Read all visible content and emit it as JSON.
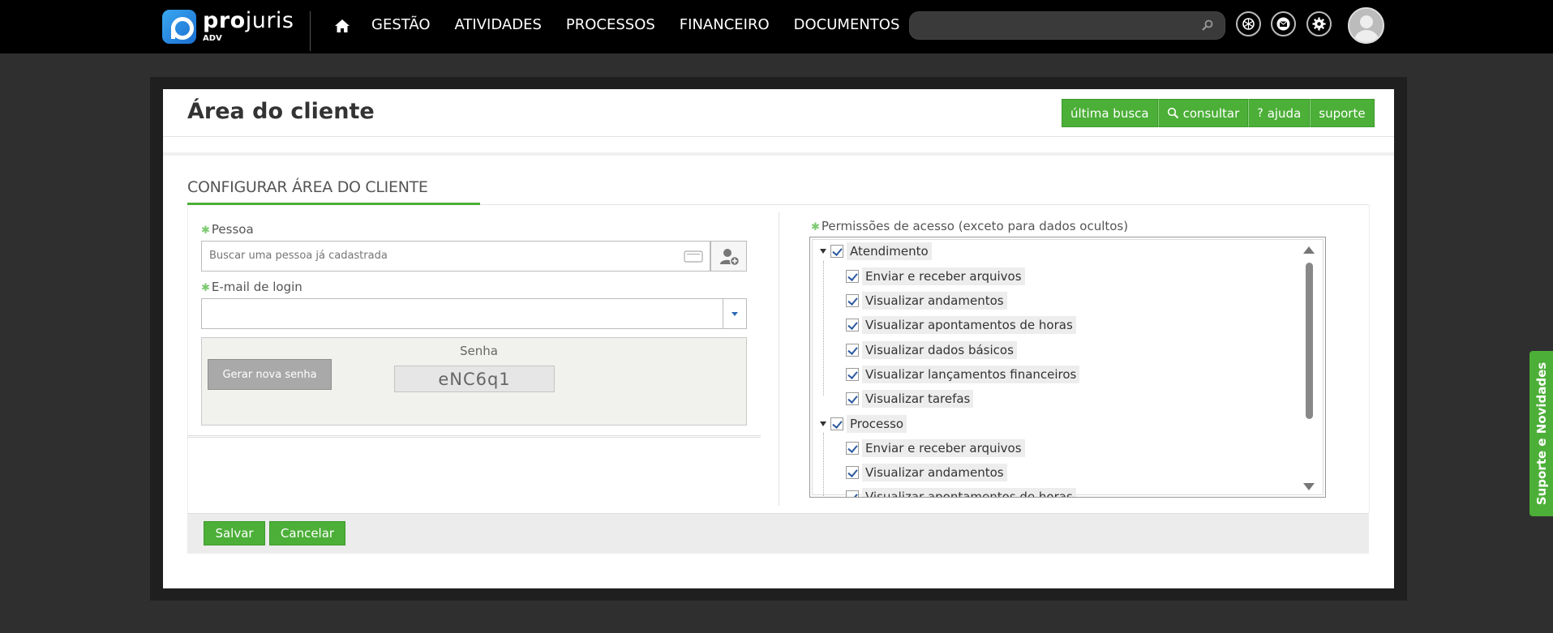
{
  "header": {
    "logo_text_bold": "pro",
    "logo_text_light": "juris",
    "logo_sub": "ADV",
    "nav": [
      "GESTÃO",
      "ATIVIDADES",
      "PROCESSOS",
      "FINANCEIRO",
      "DOCUMENTOS"
    ],
    "search_placeholder": "",
    "icons": [
      "home-icon",
      "search-icon",
      "chatgpt-icon",
      "mail-icon",
      "settings-icon",
      "avatar"
    ]
  },
  "page": {
    "title": "Área do cliente",
    "actions": [
      {
        "label": "última busca",
        "icon": ""
      },
      {
        "label": "consultar",
        "icon": "search-icon"
      },
      {
        "label": "ajuda",
        "icon": "question-icon"
      },
      {
        "label": "suporte",
        "icon": ""
      }
    ],
    "section_title": "CONFIGURAR ÁREA DO CLIENTE"
  },
  "form": {
    "pessoa_label": "Pessoa",
    "pessoa_placeholder": "Buscar uma pessoa já cadastrada",
    "email_label": "E-mail de login",
    "email_value": "",
    "senha_label": "Senha",
    "gerar_label": "Gerar nova senha",
    "senha_value": "eNC6q1"
  },
  "permissions": {
    "label": "Permissões de acesso (exceto para dados ocultos)",
    "groups": [
      {
        "label": "Atendimento",
        "checked": true,
        "items": [
          "Enviar e receber arquivos",
          "Visualizar andamentos",
          "Visualizar apontamentos de horas",
          "Visualizar dados básicos",
          "Visualizar lançamentos financeiros",
          "Visualizar tarefas"
        ]
      },
      {
        "label": "Processo",
        "checked": true,
        "items": [
          "Enviar e receber arquivos",
          "Visualizar andamentos",
          "Visualizar apontamentos de horas"
        ]
      }
    ]
  },
  "footer": {
    "save_label": "Salvar",
    "cancel_label": "Cancelar"
  },
  "side_tab": "Suporte e Novidades",
  "colors": {
    "accent_green": "#4caf38",
    "topbar": "#000000",
    "background": "#2f2f2f"
  }
}
